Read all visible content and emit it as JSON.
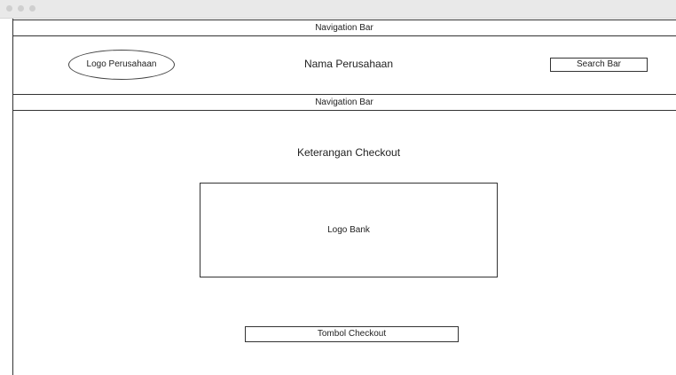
{
  "window": {
    "controls": [
      "close-dot",
      "minimize-dot",
      "maximize-dot"
    ]
  },
  "nav_top": {
    "label": "Navigation Bar"
  },
  "header": {
    "logo_label": "Logo Perusahaan",
    "company_name": "Nama Perusahaan",
    "search_label": "Search Bar"
  },
  "nav_second": {
    "label": "Navigation Bar"
  },
  "main": {
    "checkout_info": "Keterangan Checkout",
    "bank_logo_label": "Logo Bank",
    "checkout_button_label": "Tombol Checkout"
  }
}
